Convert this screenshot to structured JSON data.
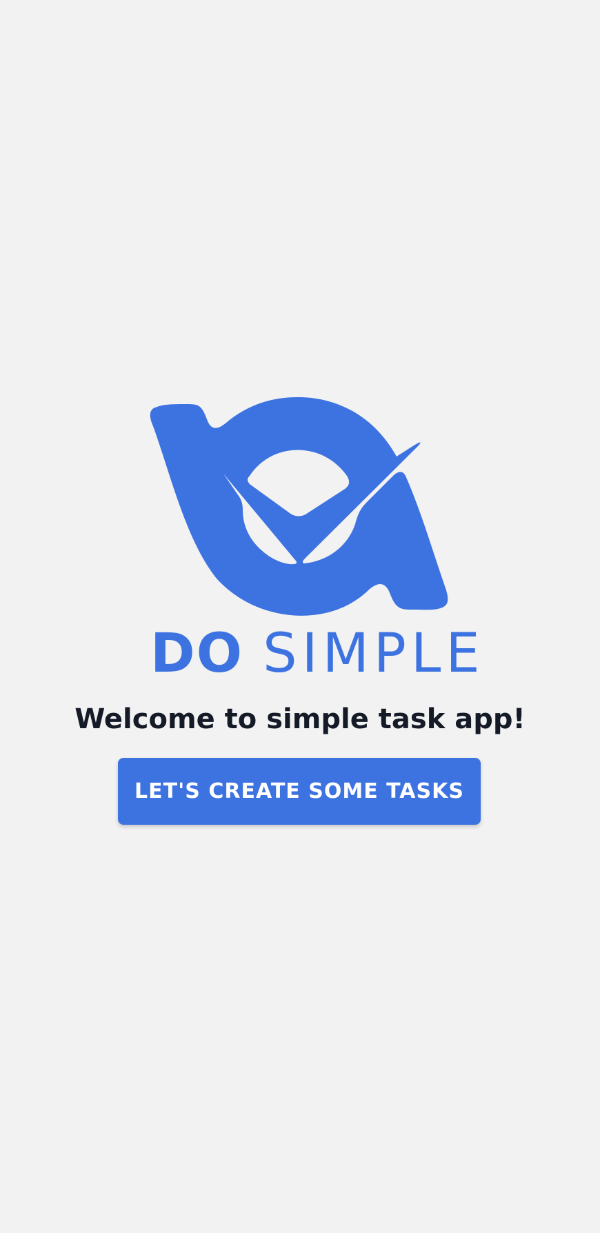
{
  "colors": {
    "background": "#f2f2f2",
    "brand": "#3d72e1",
    "text": "#141a26",
    "button_text": "#ffffff"
  },
  "brand": {
    "bold": "DO",
    "light": "SIMPLE"
  },
  "welcome_text": "Welcome to simple task app!",
  "cta_label": "LET'S CREATE SOME TASKS",
  "icons": {
    "logo": "checkmark-eye-logo-icon"
  }
}
